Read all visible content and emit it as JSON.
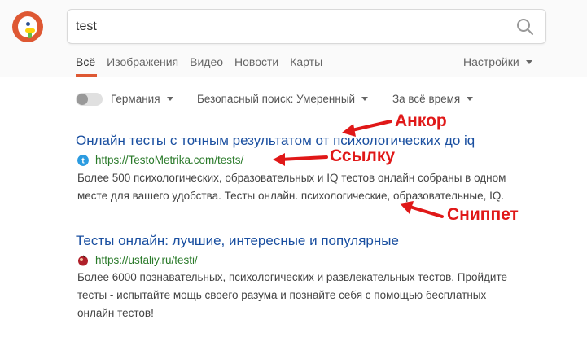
{
  "search": {
    "query": "test"
  },
  "nav": {
    "tabs": [
      {
        "label": "Всё",
        "active": true
      },
      {
        "label": "Изображения",
        "active": false
      },
      {
        "label": "Видео",
        "active": false
      },
      {
        "label": "Новости",
        "active": false
      },
      {
        "label": "Карты",
        "active": false
      }
    ],
    "settings_label": "Настройки"
  },
  "filters": {
    "region": "Германия",
    "safe_search": "Безопасный поиск: Умеренный",
    "time": "За всё время"
  },
  "results": [
    {
      "title": "Онлайн тесты с точным результатом от психологических до iq",
      "url": "https://TestoMetrika.com/tests/",
      "snippet_lines": [
        "Более 500 психологических, образовательных и IQ тестов онлайн собраны в одном",
        "месте для вашего удобства. Тесты онлайн. психологические, образовательные, IQ."
      ]
    },
    {
      "title": "Тесты онлайн: лучшие, интересные и популярные",
      "url": "https://ustaliy.ru/testi/",
      "snippet_lines": [
        "Более 6000 познавательных, психологических и развлекательных тестов. Пройдите",
        "тесты - испытайте мощь своего разума и познайте себя с помощью бесплатных",
        "онлайн тестов!"
      ]
    }
  ],
  "annotations": {
    "anchor": "Анкор",
    "link": "Ссылку",
    "snippet": "Сниппет"
  },
  "colors": {
    "brand": "#de5833",
    "title_link": "#1a4fa0",
    "url": "#2a7a2a",
    "annotation": "#e01818"
  }
}
